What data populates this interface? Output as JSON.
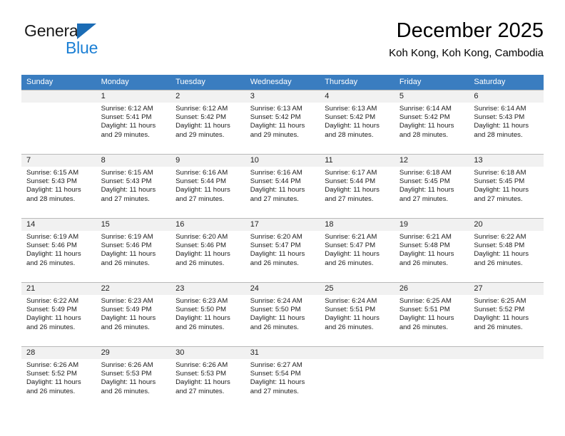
{
  "brand": {
    "name_top": "General",
    "name_bottom": "Blue",
    "accent_color": "#1b7fd4",
    "triangle_color": "#1b6cb5"
  },
  "header": {
    "title": "December 2025",
    "subtitle": "Koh Kong, Koh Kong, Cambodia"
  },
  "calendar": {
    "header_background": "#3a7dc0",
    "header_text_color": "#ffffff",
    "daynum_background": "#f1f1f1",
    "weekday_headers": [
      "Sunday",
      "Monday",
      "Tuesday",
      "Wednesday",
      "Thursday",
      "Friday",
      "Saturday"
    ],
    "weeks": [
      [
        {
          "day": "",
          "sunrise": "",
          "sunset": "",
          "daylight_line1": "",
          "daylight_line2": ""
        },
        {
          "day": "1",
          "sunrise": "Sunrise: 6:12 AM",
          "sunset": "Sunset: 5:41 PM",
          "daylight_line1": "Daylight: 11 hours",
          "daylight_line2": "and 29 minutes."
        },
        {
          "day": "2",
          "sunrise": "Sunrise: 6:12 AM",
          "sunset": "Sunset: 5:42 PM",
          "daylight_line1": "Daylight: 11 hours",
          "daylight_line2": "and 29 minutes."
        },
        {
          "day": "3",
          "sunrise": "Sunrise: 6:13 AM",
          "sunset": "Sunset: 5:42 PM",
          "daylight_line1": "Daylight: 11 hours",
          "daylight_line2": "and 29 minutes."
        },
        {
          "day": "4",
          "sunrise": "Sunrise: 6:13 AM",
          "sunset": "Sunset: 5:42 PM",
          "daylight_line1": "Daylight: 11 hours",
          "daylight_line2": "and 28 minutes."
        },
        {
          "day": "5",
          "sunrise": "Sunrise: 6:14 AM",
          "sunset": "Sunset: 5:42 PM",
          "daylight_line1": "Daylight: 11 hours",
          "daylight_line2": "and 28 minutes."
        },
        {
          "day": "6",
          "sunrise": "Sunrise: 6:14 AM",
          "sunset": "Sunset: 5:43 PM",
          "daylight_line1": "Daylight: 11 hours",
          "daylight_line2": "and 28 minutes."
        }
      ],
      [
        {
          "day": "7",
          "sunrise": "Sunrise: 6:15 AM",
          "sunset": "Sunset: 5:43 PM",
          "daylight_line1": "Daylight: 11 hours",
          "daylight_line2": "and 28 minutes."
        },
        {
          "day": "8",
          "sunrise": "Sunrise: 6:15 AM",
          "sunset": "Sunset: 5:43 PM",
          "daylight_line1": "Daylight: 11 hours",
          "daylight_line2": "and 27 minutes."
        },
        {
          "day": "9",
          "sunrise": "Sunrise: 6:16 AM",
          "sunset": "Sunset: 5:44 PM",
          "daylight_line1": "Daylight: 11 hours",
          "daylight_line2": "and 27 minutes."
        },
        {
          "day": "10",
          "sunrise": "Sunrise: 6:16 AM",
          "sunset": "Sunset: 5:44 PM",
          "daylight_line1": "Daylight: 11 hours",
          "daylight_line2": "and 27 minutes."
        },
        {
          "day": "11",
          "sunrise": "Sunrise: 6:17 AM",
          "sunset": "Sunset: 5:44 PM",
          "daylight_line1": "Daylight: 11 hours",
          "daylight_line2": "and 27 minutes."
        },
        {
          "day": "12",
          "sunrise": "Sunrise: 6:18 AM",
          "sunset": "Sunset: 5:45 PM",
          "daylight_line1": "Daylight: 11 hours",
          "daylight_line2": "and 27 minutes."
        },
        {
          "day": "13",
          "sunrise": "Sunrise: 6:18 AM",
          "sunset": "Sunset: 5:45 PM",
          "daylight_line1": "Daylight: 11 hours",
          "daylight_line2": "and 27 minutes."
        }
      ],
      [
        {
          "day": "14",
          "sunrise": "Sunrise: 6:19 AM",
          "sunset": "Sunset: 5:46 PM",
          "daylight_line1": "Daylight: 11 hours",
          "daylight_line2": "and 26 minutes."
        },
        {
          "day": "15",
          "sunrise": "Sunrise: 6:19 AM",
          "sunset": "Sunset: 5:46 PM",
          "daylight_line1": "Daylight: 11 hours",
          "daylight_line2": "and 26 minutes."
        },
        {
          "day": "16",
          "sunrise": "Sunrise: 6:20 AM",
          "sunset": "Sunset: 5:46 PM",
          "daylight_line1": "Daylight: 11 hours",
          "daylight_line2": "and 26 minutes."
        },
        {
          "day": "17",
          "sunrise": "Sunrise: 6:20 AM",
          "sunset": "Sunset: 5:47 PM",
          "daylight_line1": "Daylight: 11 hours",
          "daylight_line2": "and 26 minutes."
        },
        {
          "day": "18",
          "sunrise": "Sunrise: 6:21 AM",
          "sunset": "Sunset: 5:47 PM",
          "daylight_line1": "Daylight: 11 hours",
          "daylight_line2": "and 26 minutes."
        },
        {
          "day": "19",
          "sunrise": "Sunrise: 6:21 AM",
          "sunset": "Sunset: 5:48 PM",
          "daylight_line1": "Daylight: 11 hours",
          "daylight_line2": "and 26 minutes."
        },
        {
          "day": "20",
          "sunrise": "Sunrise: 6:22 AM",
          "sunset": "Sunset: 5:48 PM",
          "daylight_line1": "Daylight: 11 hours",
          "daylight_line2": "and 26 minutes."
        }
      ],
      [
        {
          "day": "21",
          "sunrise": "Sunrise: 6:22 AM",
          "sunset": "Sunset: 5:49 PM",
          "daylight_line1": "Daylight: 11 hours",
          "daylight_line2": "and 26 minutes."
        },
        {
          "day": "22",
          "sunrise": "Sunrise: 6:23 AM",
          "sunset": "Sunset: 5:49 PM",
          "daylight_line1": "Daylight: 11 hours",
          "daylight_line2": "and 26 minutes."
        },
        {
          "day": "23",
          "sunrise": "Sunrise: 6:23 AM",
          "sunset": "Sunset: 5:50 PM",
          "daylight_line1": "Daylight: 11 hours",
          "daylight_line2": "and 26 minutes."
        },
        {
          "day": "24",
          "sunrise": "Sunrise: 6:24 AM",
          "sunset": "Sunset: 5:50 PM",
          "daylight_line1": "Daylight: 11 hours",
          "daylight_line2": "and 26 minutes."
        },
        {
          "day": "25",
          "sunrise": "Sunrise: 6:24 AM",
          "sunset": "Sunset: 5:51 PM",
          "daylight_line1": "Daylight: 11 hours",
          "daylight_line2": "and 26 minutes."
        },
        {
          "day": "26",
          "sunrise": "Sunrise: 6:25 AM",
          "sunset": "Sunset: 5:51 PM",
          "daylight_line1": "Daylight: 11 hours",
          "daylight_line2": "and 26 minutes."
        },
        {
          "day": "27",
          "sunrise": "Sunrise: 6:25 AM",
          "sunset": "Sunset: 5:52 PM",
          "daylight_line1": "Daylight: 11 hours",
          "daylight_line2": "and 26 minutes."
        }
      ],
      [
        {
          "day": "28",
          "sunrise": "Sunrise: 6:26 AM",
          "sunset": "Sunset: 5:52 PM",
          "daylight_line1": "Daylight: 11 hours",
          "daylight_line2": "and 26 minutes."
        },
        {
          "day": "29",
          "sunrise": "Sunrise: 6:26 AM",
          "sunset": "Sunset: 5:53 PM",
          "daylight_line1": "Daylight: 11 hours",
          "daylight_line2": "and 26 minutes."
        },
        {
          "day": "30",
          "sunrise": "Sunrise: 6:26 AM",
          "sunset": "Sunset: 5:53 PM",
          "daylight_line1": "Daylight: 11 hours",
          "daylight_line2": "and 27 minutes."
        },
        {
          "day": "31",
          "sunrise": "Sunrise: 6:27 AM",
          "sunset": "Sunset: 5:54 PM",
          "daylight_line1": "Daylight: 11 hours",
          "daylight_line2": "and 27 minutes."
        },
        {
          "day": "",
          "sunrise": "",
          "sunset": "",
          "daylight_line1": "",
          "daylight_line2": ""
        },
        {
          "day": "",
          "sunrise": "",
          "sunset": "",
          "daylight_line1": "",
          "daylight_line2": ""
        },
        {
          "day": "",
          "sunrise": "",
          "sunset": "",
          "daylight_line1": "",
          "daylight_line2": ""
        }
      ]
    ]
  }
}
